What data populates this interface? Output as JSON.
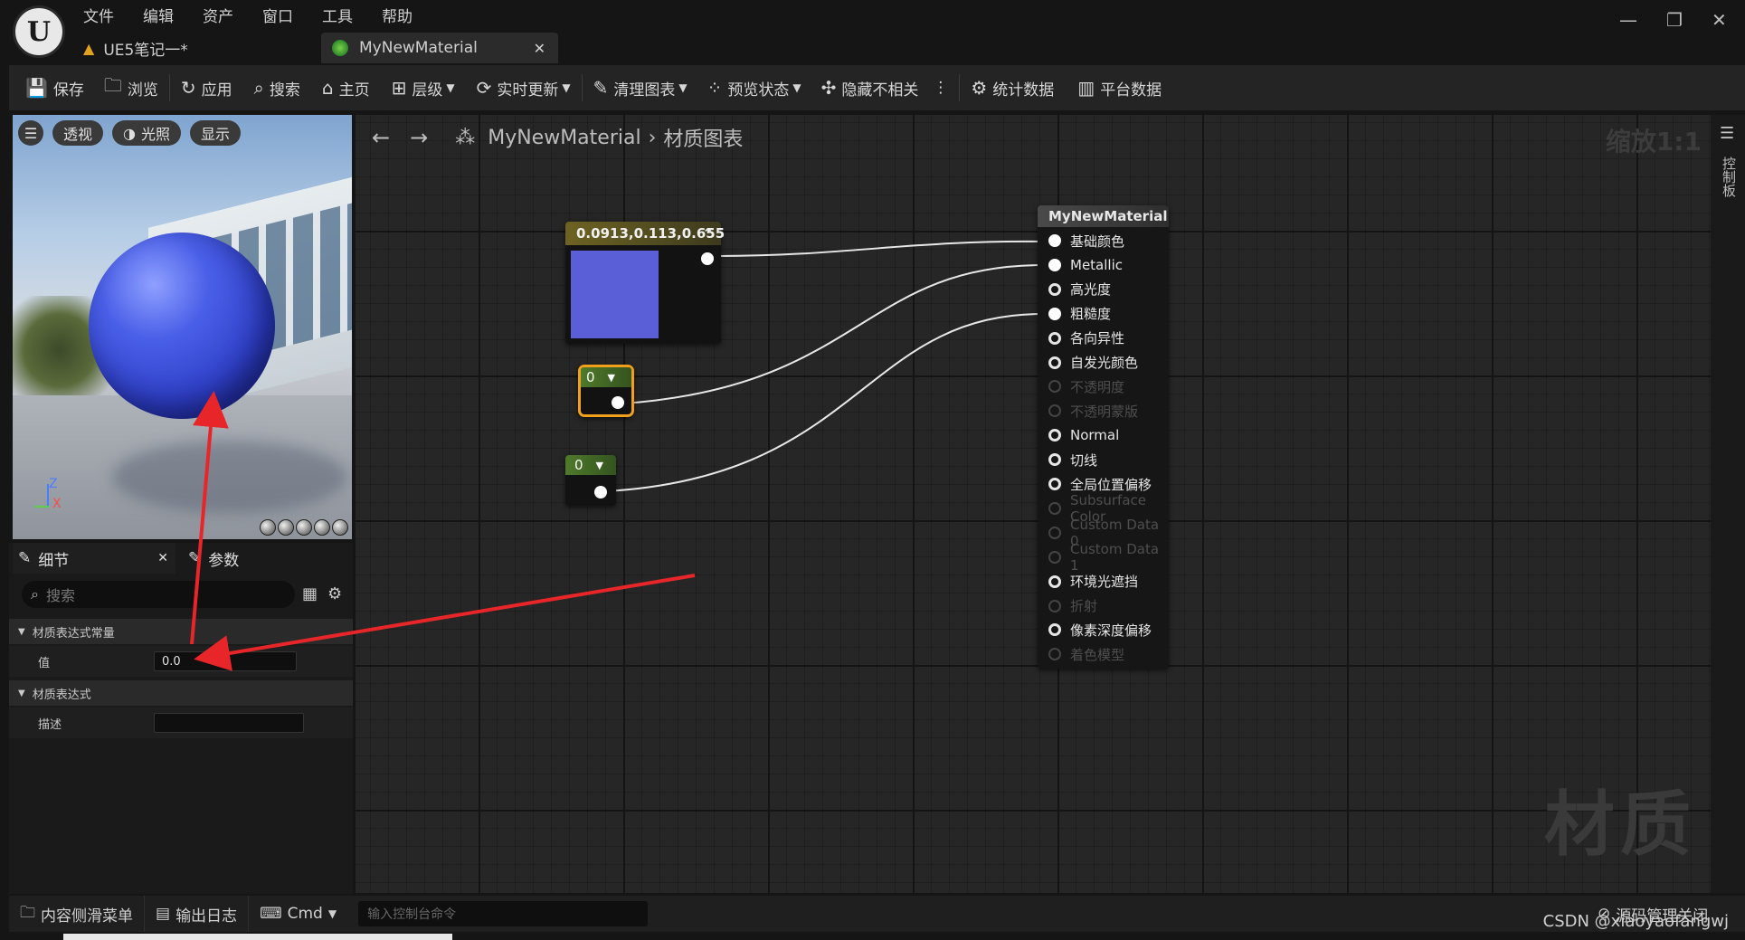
{
  "app": {
    "menu": [
      "文件",
      "编辑",
      "资产",
      "窗口",
      "工具",
      "帮助"
    ],
    "tabs": [
      {
        "label": "UE5笔记一*"
      },
      {
        "label": "MyNewMaterial"
      }
    ]
  },
  "toolbar": {
    "save": "保存",
    "browse": "浏览",
    "apply": "应用",
    "search": "搜索",
    "home": "主页",
    "hierarchy": "层级",
    "live_update": "实时更新",
    "clean_graph": "清理图表",
    "preview_state": "预览状态",
    "hide_unrelated": "隐藏不相关",
    "stats": "统计数据",
    "platform_stats": "平台数据"
  },
  "viewport": {
    "perspective": "透视",
    "lighting": "光照",
    "show": "显示",
    "axis_z": "Z",
    "axis_x": "X"
  },
  "details": {
    "tab_details": "细节",
    "tab_params": "参数",
    "search_placeholder": "搜索",
    "cat1": "材质表达式常量",
    "prop_value_label": "值",
    "prop_value": "0.0",
    "cat2": "材质表达式",
    "prop_desc_label": "描述",
    "prop_desc": ""
  },
  "graph": {
    "breadcrumb_asset": "MyNewMaterial",
    "breadcrumb_graph": "材质图表",
    "zoom": "缩放1:1",
    "watermark": "材质",
    "side_tab": "控制板",
    "vector_node_title": "0.0913,0.113,0.655",
    "vector_color": "#5a5fd8",
    "const1_value": "0",
    "const2_value": "0",
    "material_node_title": "MyNewMaterial",
    "inputs": [
      {
        "label": "基础颜色",
        "state": "connected"
      },
      {
        "label": "Metallic",
        "state": "connected"
      },
      {
        "label": "高光度",
        "state": "open"
      },
      {
        "label": "粗糙度",
        "state": "connected"
      },
      {
        "label": "各向异性",
        "state": "open"
      },
      {
        "label": "自发光颜色",
        "state": "open"
      },
      {
        "label": "不透明度",
        "state": "disabled"
      },
      {
        "label": "不透明蒙版",
        "state": "disabled"
      },
      {
        "label": "Normal",
        "state": "open"
      },
      {
        "label": "切线",
        "state": "open"
      },
      {
        "label": "全局位置偏移",
        "state": "open"
      },
      {
        "label": "Subsurface Color",
        "state": "disabled"
      },
      {
        "label": "Custom Data 0",
        "state": "disabled"
      },
      {
        "label": "Custom Data 1",
        "state": "disabled"
      },
      {
        "label": "环境光遮挡",
        "state": "open"
      },
      {
        "label": "折射",
        "state": "disabled"
      },
      {
        "label": "像素深度偏移",
        "state": "open"
      },
      {
        "label": "着色模型",
        "state": "disabled"
      }
    ]
  },
  "bottom": {
    "content_drawer": "内容侧滑菜单",
    "output_log": "输出日志",
    "cmd": "Cmd",
    "cmd_placeholder": "输入控制台命令",
    "source_control": "源码管理关闭",
    "credit": "CSDN @xiaoyaofangwj"
  },
  "colors": {
    "accent_annotation": "#e8262a",
    "selected_node_border": "#f0a01a"
  }
}
